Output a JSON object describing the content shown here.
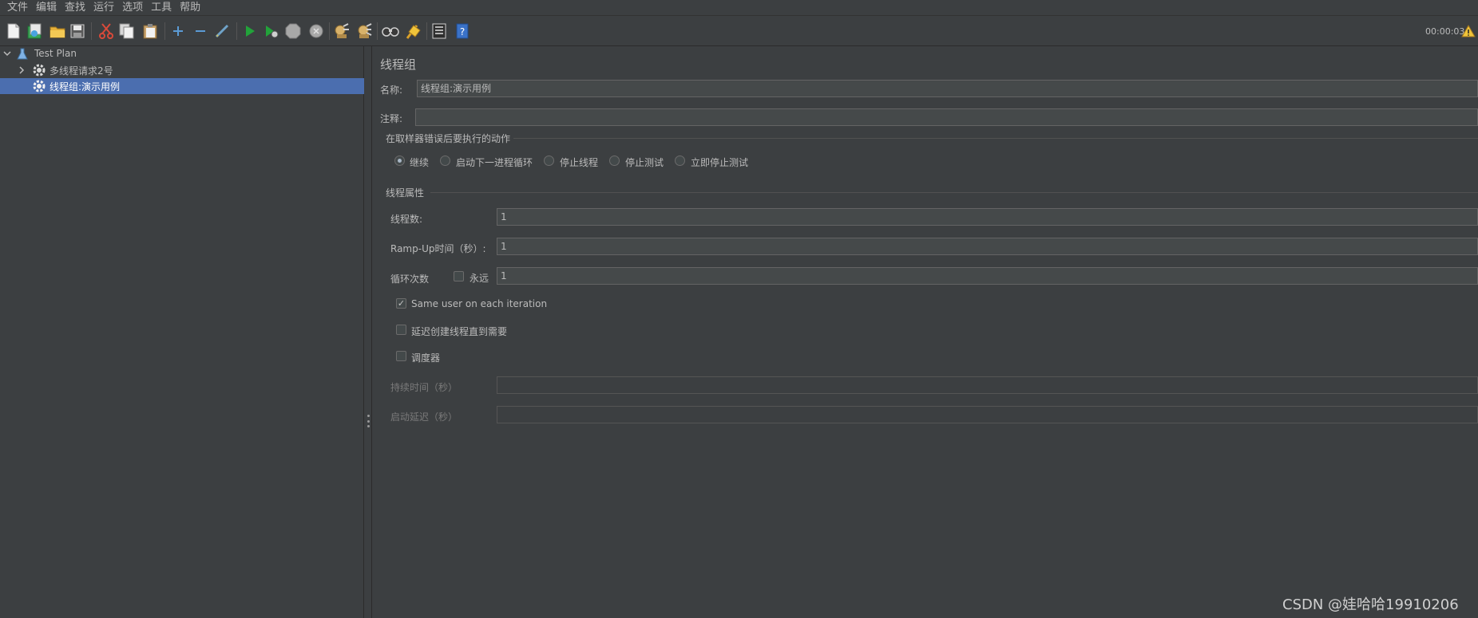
{
  "menu": [
    "文件",
    "编辑",
    "查找",
    "运行",
    "选项",
    "工具",
    "帮助"
  ],
  "toolbar": {
    "icons": [
      "new-icon",
      "templates-icon",
      "open-icon",
      "save-icon",
      "cut-icon",
      "copy-icon",
      "paste-icon",
      "expand-icon",
      "collapse-icon",
      "toggle-icon",
      "start-icon",
      "start-no-pause-icon",
      "stop-icon",
      "shutdown-icon",
      "clear-icon",
      "clear-all-icon",
      "search-icon",
      "reset-search-icon",
      "function-helper-icon",
      "help-icon"
    ],
    "timer": "00:00:03"
  },
  "tree": {
    "items": [
      {
        "label": "Test Plan"
      },
      {
        "label": "多线程请求2号"
      },
      {
        "label": "线程组:演示用例"
      }
    ]
  },
  "panel": {
    "title": "线程组",
    "name_label": "名称:",
    "name_value": "线程组:演示用例",
    "comment_label": "注释:",
    "comment_value": "",
    "error_group_title": "在取样器错误后要执行的动作",
    "error_actions": [
      "继续",
      "启动下一进程循环",
      "停止线程",
      "停止测试",
      "立即停止测试"
    ],
    "selected_action": "继续",
    "thread_group_title": "线程属性",
    "threads_label": "线程数:",
    "threads_value": "1",
    "rampup_label": "Ramp-Up时间（秒）:",
    "rampup_value": "1",
    "loop_label": "循环次数",
    "forever_label": "永远",
    "loop_value": "1",
    "same_user_label": "Same user on each iteration",
    "same_user_checked": true,
    "delay_label": "延迟创建线程直到需要",
    "scheduler_label": "调度器",
    "duration_label": "持续时间（秒）",
    "startup_delay_label": "启动延迟（秒）"
  },
  "watermark": "CSDN @娃哈哈19910206",
  "colors": {
    "background": "#3c3f41",
    "selection": "#4b6eaf",
    "field": "#45494a"
  }
}
